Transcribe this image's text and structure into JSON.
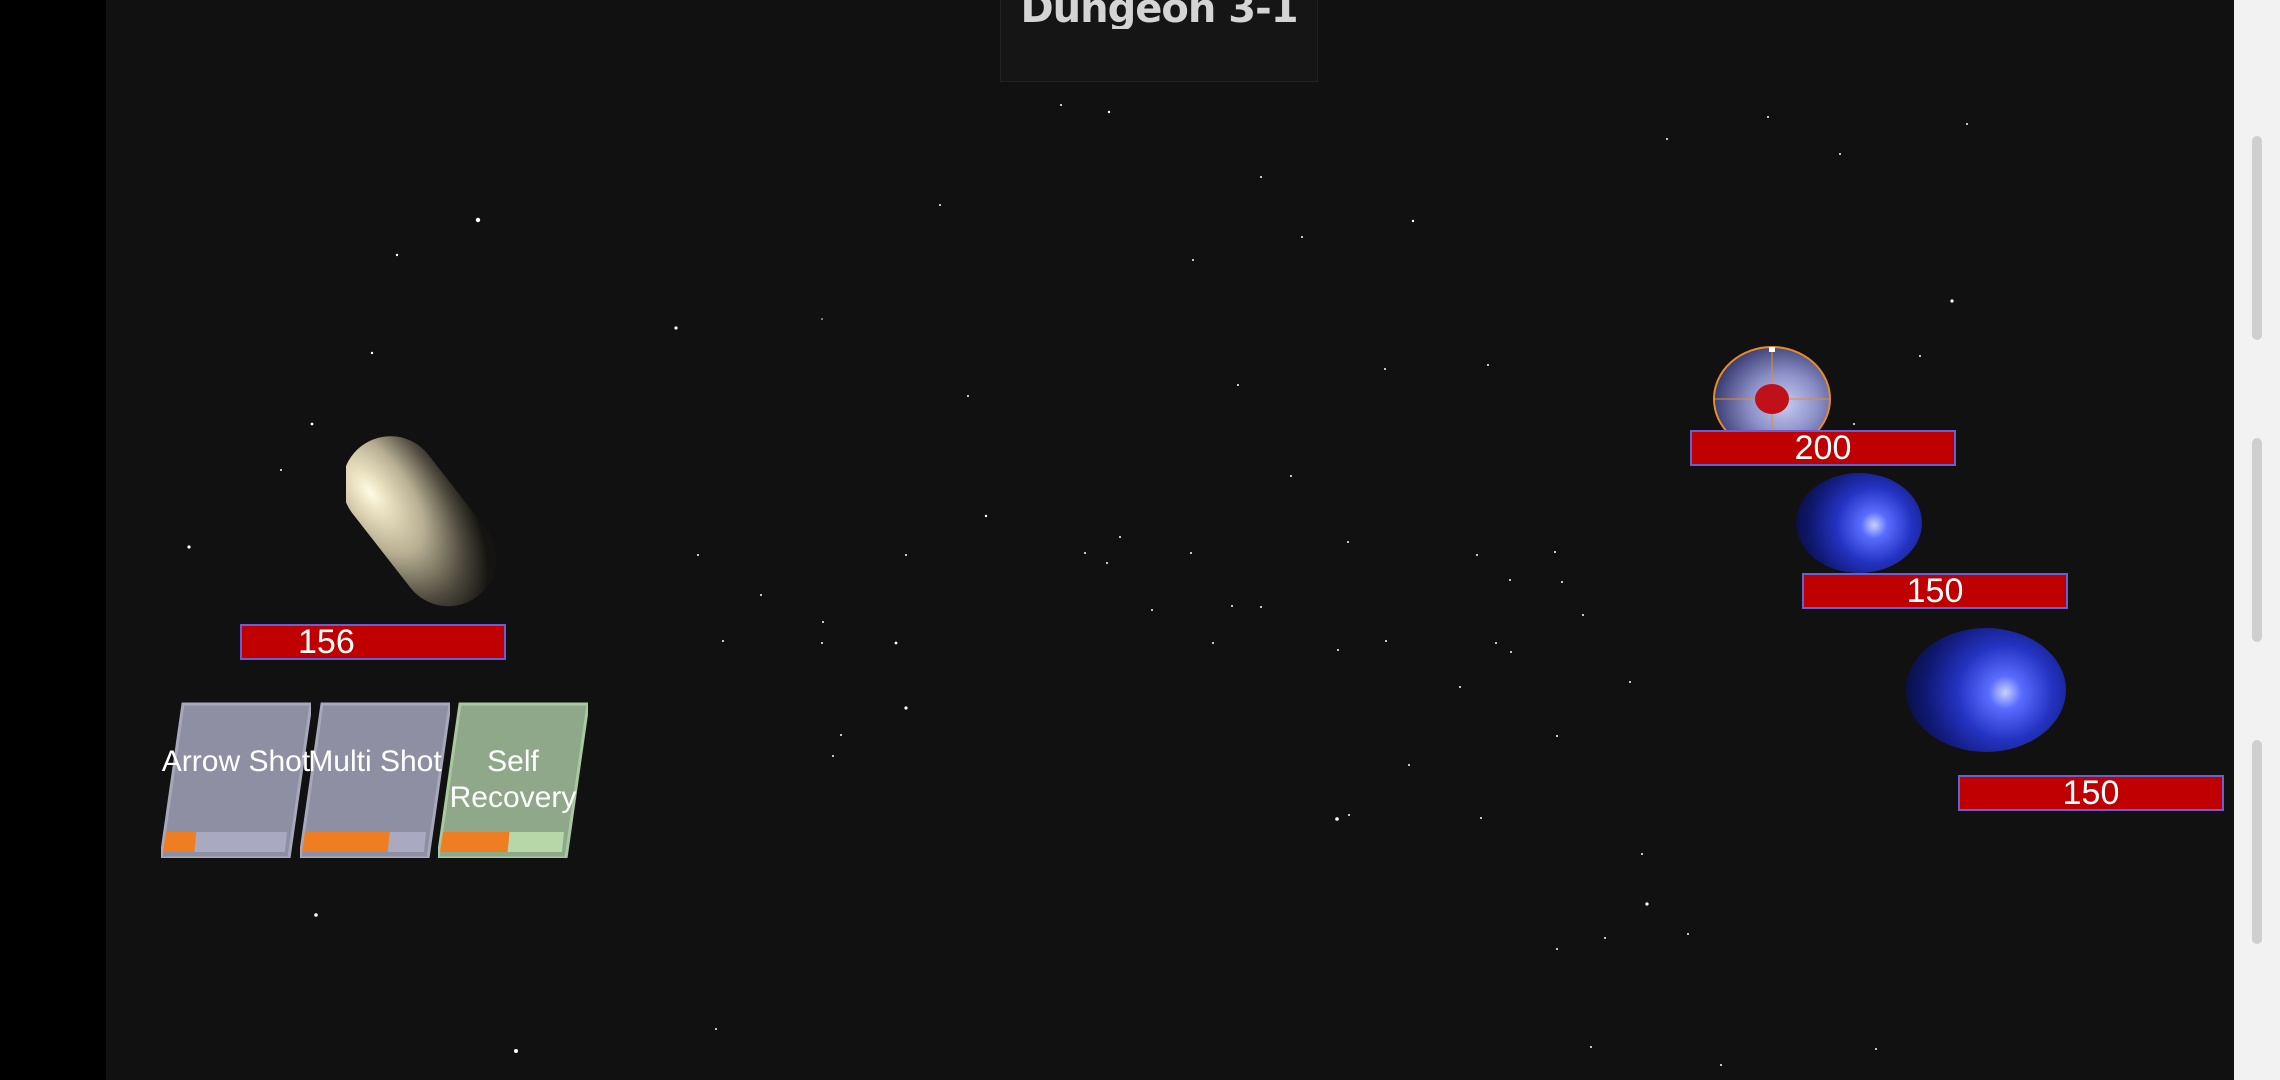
{
  "stage": {
    "title": "Dungeon 3-1"
  },
  "player": {
    "hp": "156"
  },
  "enemies": [
    {
      "hp": "200",
      "targeted": true
    },
    {
      "hp": "150",
      "targeted": false
    },
    {
      "hp": "150",
      "targeted": false
    }
  ],
  "skills": [
    {
      "label": "Arrow Shot",
      "cooldown": 0.25,
      "style": "grey"
    },
    {
      "label": "Multi Shot",
      "cooldown": 0.7,
      "style": "grey"
    },
    {
      "label": "Self Recovery",
      "cooldown": 0.55,
      "style": "green"
    }
  ],
  "colors": {
    "background": "#111111",
    "hp_bar": "#c00000",
    "hp_border": "#6a5fd0",
    "cooldown": "#ef7d22",
    "skill_grey": "#8e8fa2",
    "skill_green": "#8fa88a"
  }
}
